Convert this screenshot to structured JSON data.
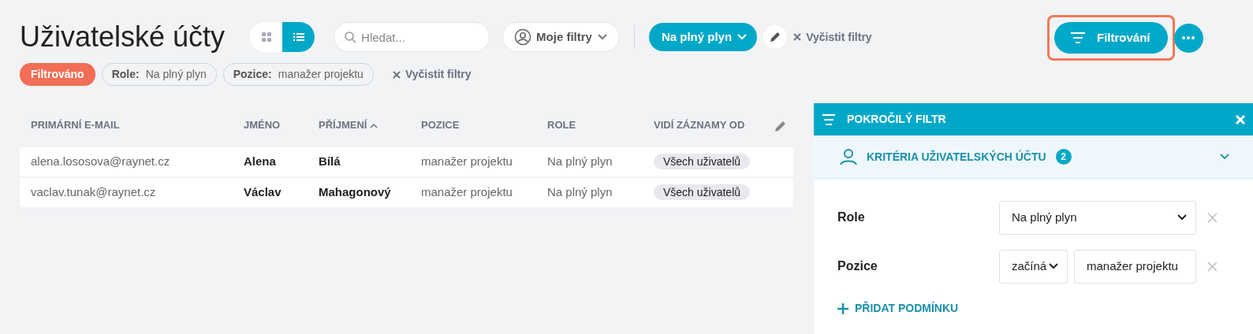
{
  "toolbar": {
    "title": "Uživatelské účty",
    "view_modes": [
      {
        "kind": "grid",
        "selected": false
      },
      {
        "kind": "list",
        "selected": true
      }
    ],
    "search": {
      "placeholder": "Hledat..."
    },
    "my_filters": "Moje filtry",
    "active_filter": "Na plný plyn",
    "clear_filters": "Vyčistit filtry",
    "filter_button": {
      "label": "Filtrování",
      "highlighted": true
    }
  },
  "filter_chips": {
    "status": "Filtrováno",
    "chips": [
      {
        "label": "Role:",
        "value": "Na plný plyn"
      },
      {
        "label": "Pozice:",
        "value": "manažer projektu"
      }
    ],
    "clear": "Vyčistit filtry"
  },
  "table": {
    "columns": [
      {
        "label": "PRIMÁRNÍ E-MAIL",
        "kind": "text",
        "sorted": false
      },
      {
        "label": "JMÉNO",
        "kind": "bold",
        "sorted": false
      },
      {
        "label": "PŘÍJMENÍ",
        "kind": "bold",
        "sorted": true
      },
      {
        "label": "POZICE",
        "kind": "text",
        "sorted": false
      },
      {
        "label": "ROLE",
        "kind": "text",
        "sorted": false
      },
      {
        "label": "VIDÍ ZÁZNAMY OD",
        "kind": "tag",
        "sorted": false
      }
    ],
    "rows": [
      [
        "alena.lososova@raynet.cz",
        "Alena",
        "Bílá",
        "manažer projektu",
        "Na plný plyn",
        "Všech uživatelů"
      ],
      [
        "vaclav.tunak@raynet.cz",
        "Václav",
        "Mahagonový",
        "manažer projektu",
        "Na plný plyn",
        "Všech uživatelů"
      ]
    ]
  },
  "panel": {
    "title": "POKROČILÝ FILTR",
    "section": {
      "title": "KRITÉRIA UŽIVATELSKÝCH ÚČTU",
      "count": "2"
    },
    "conditions": [
      {
        "label": "Role",
        "kind": "select",
        "value": "Na plný plyn"
      },
      {
        "label": "Pozice",
        "kind": "operator",
        "operator": "začíná",
        "value": "manažer projektu"
      }
    ],
    "add": "PŘIDAT PODMÍNKU"
  }
}
